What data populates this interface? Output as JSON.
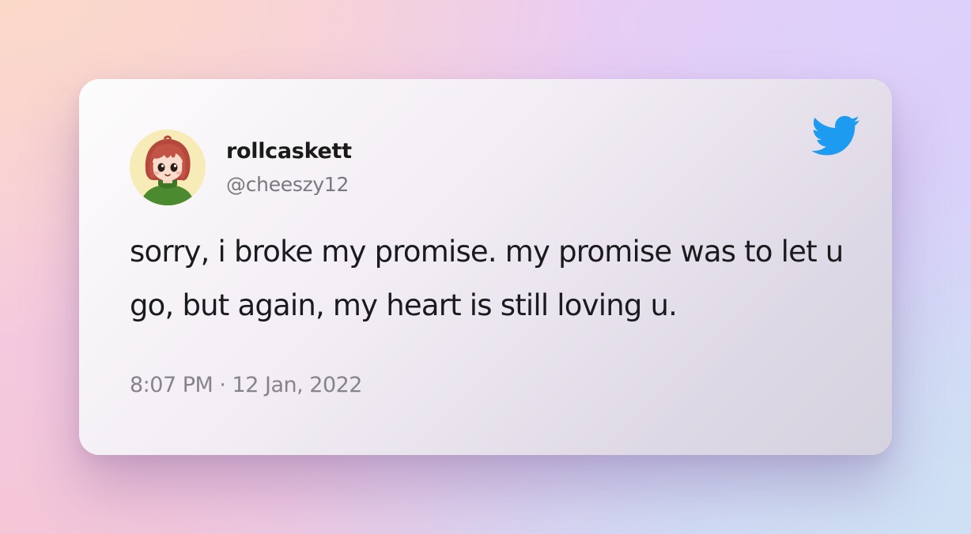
{
  "tweet": {
    "display_name": "rollcaskett",
    "handle": "@cheeszy12",
    "text": "sorry, i broke my promise. my promise was to let u go, but again, my heart is still loving u.",
    "timestamp": "8:07 PM · 12 Jan, 2022",
    "avatar_icon": "anime-girl-avatar",
    "brand_icon": "twitter-bird-icon"
  },
  "colors": {
    "brand": "#1d9bf0",
    "text_primary": "#1b1b1f",
    "text_secondary": "#7a7780"
  }
}
